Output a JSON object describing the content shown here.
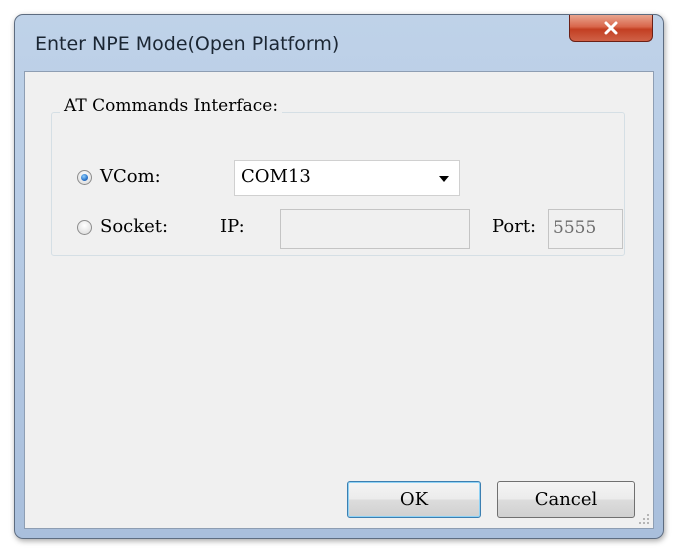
{
  "window": {
    "title": "Enter NPE Mode(Open Platform)",
    "close_icon": "close-x-icon"
  },
  "group": {
    "label": "AT Commands Interface:"
  },
  "vcom": {
    "label": "VCom:",
    "selected": true,
    "port_value": "COM13"
  },
  "socket": {
    "label": "Socket:",
    "selected": false,
    "ip_label": "IP:",
    "ip_value": "",
    "port_label": "Port:",
    "port_value": "5555"
  },
  "buttons": {
    "ok": "OK",
    "cancel": "Cancel"
  },
  "colors": {
    "title_bar": "#b9cde6",
    "close_button": "#c9482c",
    "dialog_body": "#f0f0f0",
    "radio_selected": "#2a73c9"
  }
}
